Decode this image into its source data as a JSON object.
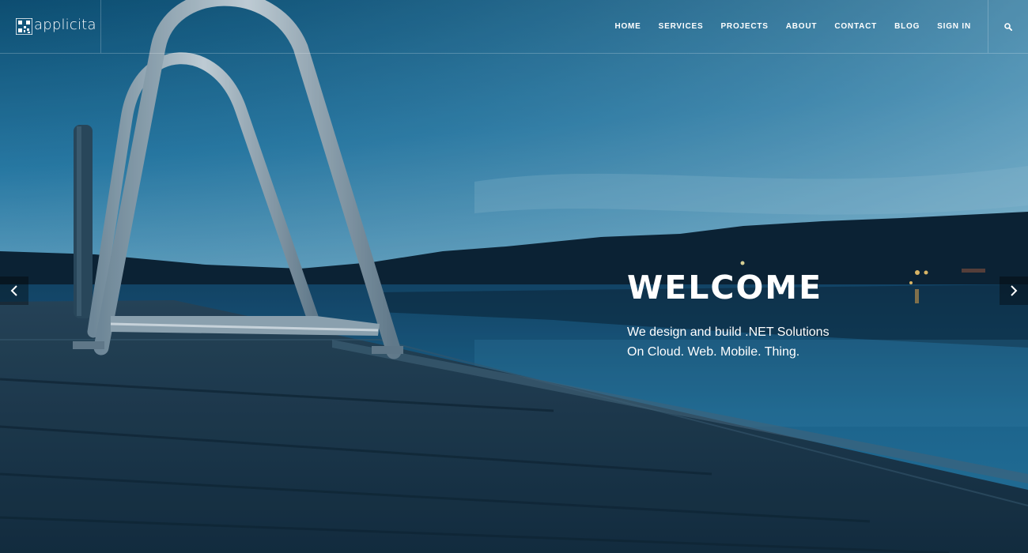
{
  "brand": {
    "name": "applicita"
  },
  "nav": {
    "items": [
      {
        "label": "HOME"
      },
      {
        "label": "SERVICES"
      },
      {
        "label": "PROJECTS"
      },
      {
        "label": "ABOUT"
      },
      {
        "label": "CONTACT"
      },
      {
        "label": "BLOG"
      },
      {
        "label": "SIGN IN"
      }
    ],
    "search_icon": "search-icon"
  },
  "hero": {
    "title": "WELCOME",
    "subtitle_line1": "We design and build .NET Solutions",
    "subtitle_line2": "On Cloud. Web. Mobile. Thing.",
    "prev_icon": "chevron-left-icon",
    "next_icon": "chevron-right-icon"
  },
  "colors": {
    "sky_top": "#0f5a85",
    "sky_bottom": "#6cb1d3",
    "water": "#1d6c94",
    "deck": "#1a3448",
    "text": "#ffffff"
  }
}
